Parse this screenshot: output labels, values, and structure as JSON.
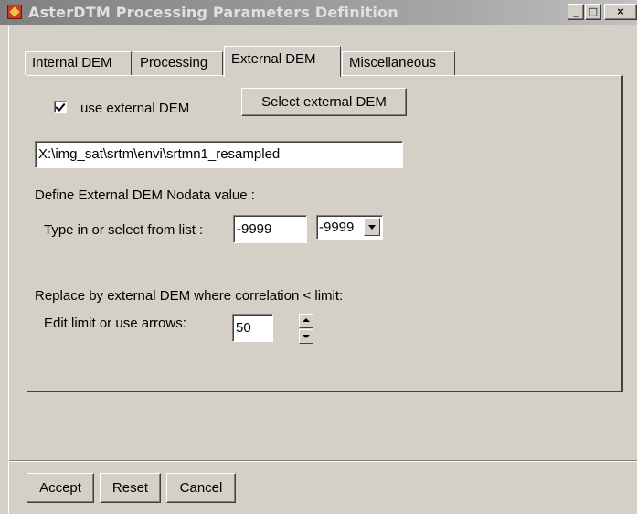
{
  "window": {
    "title": "AsterDTM Processing Parameters Definition",
    "controls": {
      "minimize": "_",
      "maximize": "□",
      "close": "×"
    }
  },
  "tabs": [
    {
      "label": "Internal DEM",
      "active": false
    },
    {
      "label": "Processing",
      "active": false
    },
    {
      "label": "External DEM",
      "active": true
    },
    {
      "label": "Miscellaneous",
      "active": false
    }
  ],
  "external_dem": {
    "use_checkbox": {
      "label": "use external DEM",
      "checked": true
    },
    "select_button": "Select external DEM",
    "path_value": "X:\\img_sat\\srtm\\envi\\srtmn1_resampled",
    "nodata_heading": "Define External DEM Nodata value :",
    "nodata_label": "Type in or select from list :",
    "nodata_value": "-9999",
    "nodata_select_value": "-9999",
    "replace_heading": "Replace by external DEM where correlation < limit:",
    "limit_label": "Edit limit or use arrows:",
    "limit_value": "50"
  },
  "footer": {
    "accept": "Accept",
    "reset": "Reset",
    "cancel": "Cancel"
  },
  "icons": [
    "app-icon",
    "check-icon",
    "chevron-down-icon",
    "spin-up-icon",
    "spin-down-icon"
  ]
}
